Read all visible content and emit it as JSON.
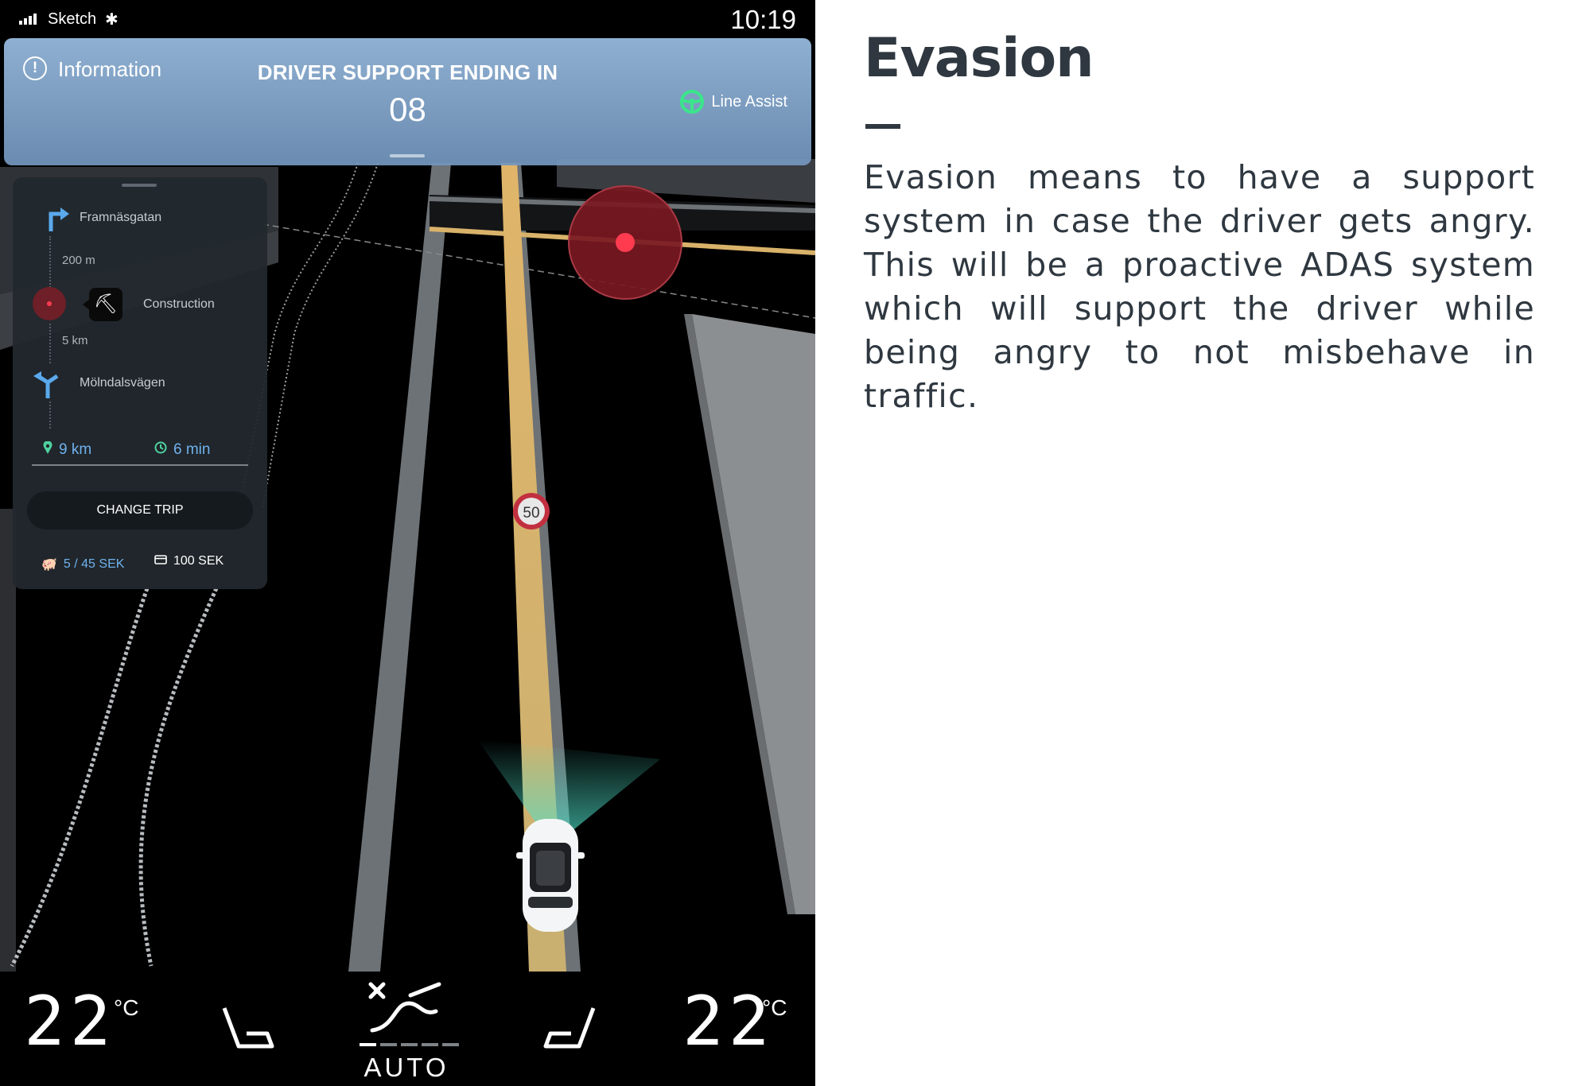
{
  "status_bar": {
    "carrier": "Sketch",
    "bluetooth_icon": "bluetooth-icon",
    "time": "10:19"
  },
  "banner": {
    "info_icon": "info-circle-icon",
    "info_glyph": "!",
    "info_label": "Information",
    "title": "DRIVER SUPPORT ENDING IN",
    "countdown": "08",
    "line_assist_icon": "steering-wheel-icon",
    "line_assist_label": "Line Assist"
  },
  "trip": {
    "steps": [
      {
        "icon": "turn-right-icon",
        "label": "Framnäsgatan"
      },
      {
        "distance": "200 m"
      },
      {
        "icon": "construction-icon",
        "label": "Construction"
      },
      {
        "distance": "5 km"
      },
      {
        "icon": "fork-icon",
        "label": "Mölndalsvägen"
      }
    ],
    "remaining_distance": "9 km",
    "remaining_time": "6 min",
    "change_trip_label": "CHANGE TRIP",
    "fare_used": "5 / 45 SEK",
    "fare_card": "100 SEK"
  },
  "map": {
    "speed_limit": "50",
    "accent": "#e9b96a",
    "hazard_color": "#ff3b4f"
  },
  "climate": {
    "left_temp": "22",
    "left_unit": "°C",
    "right_temp": "22",
    "right_unit": "°C",
    "mode": "AUTO",
    "fan_level": 1,
    "fan_levels": 5
  },
  "description": {
    "title": "Evasion",
    "body": "Evasion means to have a support system in case the driver gets angry. This will be a proactive ADAS system which will support the driver while being angry to not misbehave in traffic."
  }
}
